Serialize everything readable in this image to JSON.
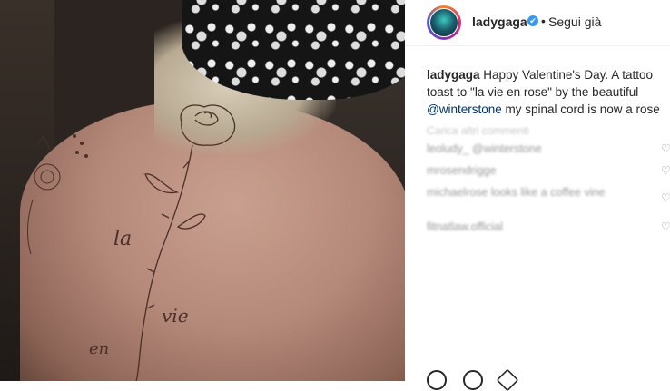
{
  "post": {
    "username": "ladygaga",
    "follow_label": "Segui già",
    "separator": "•",
    "verified_icon": "✔"
  },
  "caption": {
    "username": "ladygaga",
    "text_part1": " Happy Valentine's Day. A tattoo toast to \"la vie en rose\" by the beautiful ",
    "mention": "@winterstone",
    "text_part2": " my spinal cord is now a rose"
  },
  "comments": {
    "more_label": "Carica altri commenti",
    "items": [
      {
        "text": "leoludy_ @winterstone"
      },
      {
        "text": "mrosendrigge"
      },
      {
        "text": "michaelrose looks like a coffee vine"
      },
      {
        "text": "fitnatlaw.official"
      }
    ]
  },
  "tattoo": {
    "word1": "la",
    "word2": "vie",
    "word3": "en"
  },
  "colors": {
    "accent": "#3897f0",
    "text": "#262626",
    "mention": "#003569"
  }
}
